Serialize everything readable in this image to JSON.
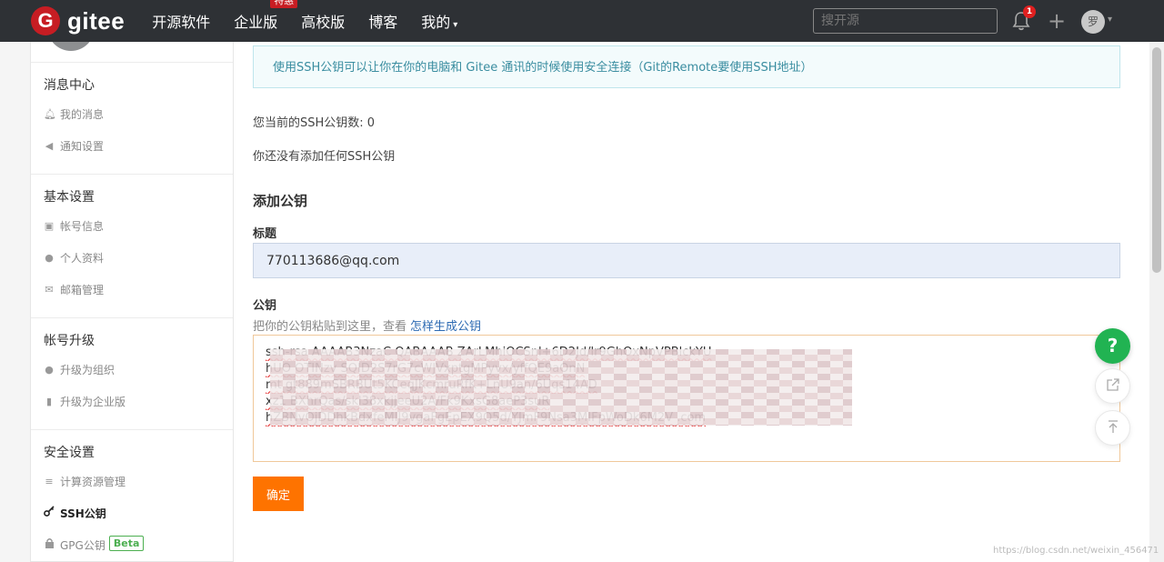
{
  "nav": {
    "logo_letter": "G",
    "logo_text": "gitee",
    "items": [
      {
        "label": "开源软件"
      },
      {
        "label": "企业版",
        "badge": "特惠"
      },
      {
        "label": "高校版"
      },
      {
        "label": "博客"
      },
      {
        "label": "我的",
        "caret": "▾"
      }
    ],
    "search_placeholder": "搜开源",
    "notification_count": "1",
    "plus_label": "+",
    "avatar_text": "罗",
    "avatar_caret": "▾"
  },
  "sidebar": {
    "sections": [
      {
        "title": "消息中心",
        "items": [
          {
            "label": "我的消息",
            "icon": "bell-icon"
          },
          {
            "label": "通知设置",
            "icon": "speaker-icon"
          }
        ]
      },
      {
        "title": "基本设置",
        "items": [
          {
            "label": "帐号信息",
            "icon": "id-card-icon"
          },
          {
            "label": "个人资料",
            "icon": "user-icon"
          },
          {
            "label": "邮箱管理",
            "icon": "envelope-icon"
          }
        ]
      },
      {
        "title": "帐号升级",
        "items": [
          {
            "label": "升级为组织",
            "icon": "group-icon"
          },
          {
            "label": "升级为企业版",
            "icon": "building-icon"
          }
        ]
      },
      {
        "title": "安全设置",
        "items": [
          {
            "label": "计算资源管理",
            "icon": "server-icon"
          },
          {
            "label": "SSH公钥",
            "icon": "key-icon",
            "active": true
          },
          {
            "label": "GPG公钥",
            "icon": "lock-icon",
            "badge": "Beta"
          }
        ]
      }
    ]
  },
  "main": {
    "info_text": "使用SSH公钥可以让你在你的电脑和 Gitee 通讯的时候使用安全连接（Git的Remote要使用SSH地址）",
    "count_text": "您当前的SSH公钥数: 0",
    "none_text": "你还没有添加任何SSH公钥",
    "add_title": "添加公钥",
    "title_label": "标题",
    "title_value": "770113686@qq.com",
    "key_label": "公钥",
    "key_hint": "把你的公钥粘贴到这里，查看",
    "key_hint_link": "怎样生成公钥",
    "key_lines": [
      "ssh-rsa AAAAB3NzaC                    QABAAAB                                                                     ZArLMhiOCSnl+6D2Jd/lr9GhOxNpVPBlckYU",
      "hUO                                   OTINzv                                                                      SQID2S7rG7cWJVxptgMPyvx/yffQE9aOnN",
      "mt                                                                                                              gt889mSBRBUt5KCeqJKcmruRfK+LnU9an/6Uqs14AD",
      "xz1                                                                                                              BXhrQas/skl38xkjjeeU2A/Fk9KxsG8aeP3suR",
      "hZBNvOjDDhkBdxfeMlJ9vgaFgEpEX9Q5d/YJmF9Nsa3MIFpWoDk6M2V                                                        .com"
    ],
    "confirm_label": "确定"
  },
  "floating": {
    "help_label": "?"
  },
  "watermark": "https://blog.csdn.net/weixin_456471"
}
